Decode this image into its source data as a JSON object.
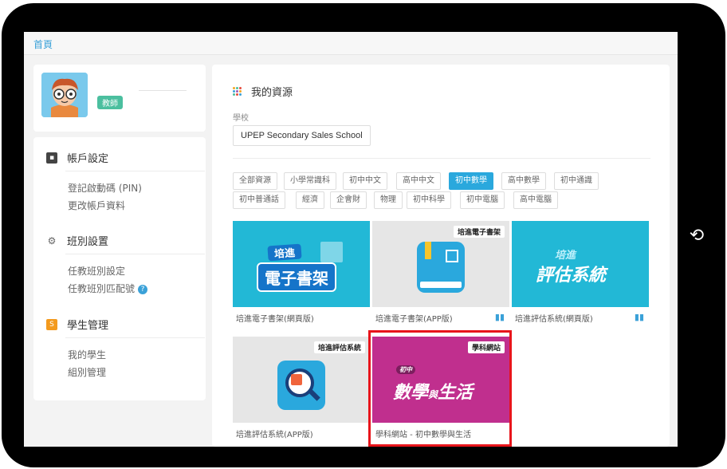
{
  "breadcrumb": "首頁",
  "profile": {
    "role_badge": "教師"
  },
  "menu": {
    "account": {
      "title": "帳戶設定",
      "links": [
        "登記啟動碼 (PIN)",
        "更改帳戶資料"
      ]
    },
    "class": {
      "title": "班別設置",
      "links": [
        "任教班別設定",
        "任教班別匹配號"
      ]
    },
    "students": {
      "title": "學生管理",
      "links": [
        "我的學生",
        "組別管理"
      ]
    }
  },
  "resources": {
    "title": "我的資源",
    "school_label": "學校",
    "school_value": "UPEP Secondary Sales School"
  },
  "filters": {
    "row1": [
      "全部資源",
      "小學常識科",
      "初中中文",
      "高中中文",
      "初中數學",
      "高中數學",
      "初中通識"
    ],
    "row2": [
      "初中普通話",
      "經濟",
      "企會財",
      "物理",
      "初中科學",
      "初中電腦",
      "高中電腦"
    ],
    "active": "初中數學"
  },
  "tiles": [
    {
      "label": "培進電子書架(網頁版)",
      "thumb_line1": "培進",
      "thumb_line2": "電子書架"
    },
    {
      "label": "培進電子書架(APP版)",
      "tag": "培進電子書架"
    },
    {
      "label": "培進評估系統(網頁版)",
      "thumb_line1": "培進",
      "thumb_line2": "評估系統"
    },
    {
      "label": "培進評估系統(APP版)",
      "tag": "培進評估系統"
    },
    {
      "label": "學科網站 - 初中數學與生活",
      "tag": "學科網站",
      "thumb_small": "初中",
      "thumb_main1": "數學",
      "thumb_mid": "與",
      "thumb_main2": "生活"
    }
  ],
  "colors": {
    "accent": "#2aa8dd",
    "highlight": "#e8141b",
    "teal": "#22b8d6",
    "magenta": "#c02f8e"
  }
}
